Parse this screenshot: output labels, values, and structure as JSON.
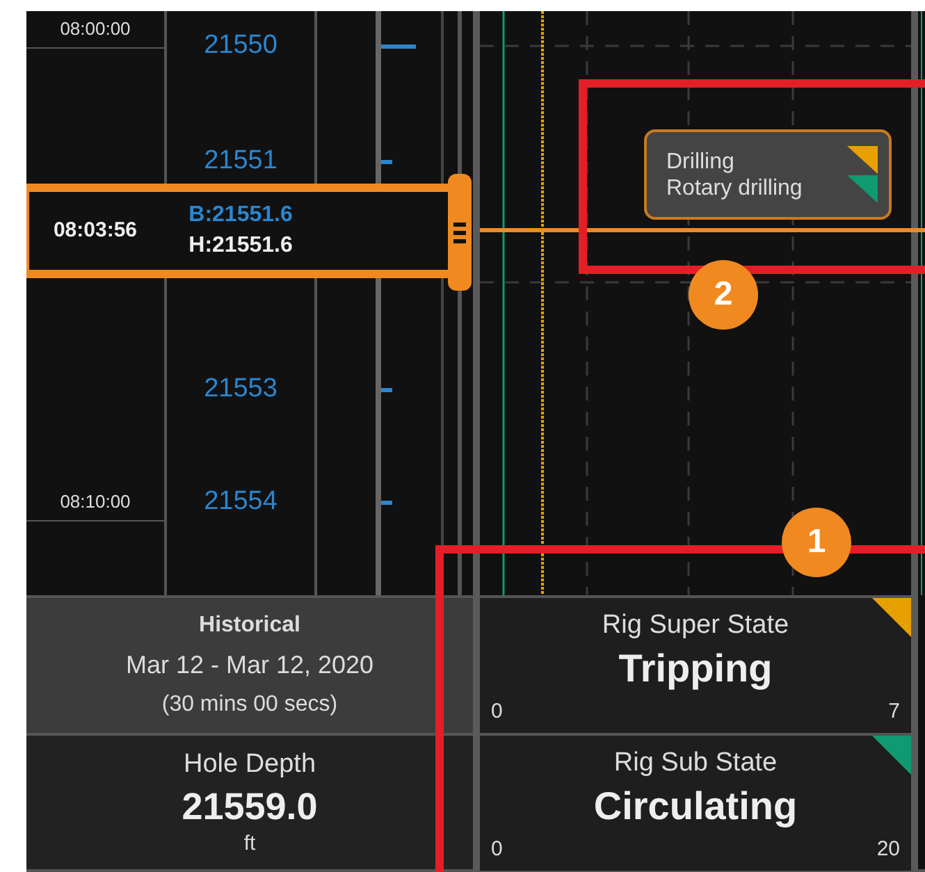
{
  "time_labels": [
    "08:00:00",
    "08:10:00"
  ],
  "depth_labels": [
    {
      "text": "21550",
      "kind": "major"
    },
    {
      "text": "21551",
      "kind": "minor"
    },
    {
      "text": "21553",
      "kind": "minor"
    },
    {
      "text": "21554",
      "kind": "minor"
    }
  ],
  "cursor": {
    "time": "08:03:56",
    "bit_depth": "B:21551.6",
    "hole_depth": "H:21551.6"
  },
  "state_tooltip": {
    "states": [
      {
        "text": "Drilling",
        "color": "#e8a000"
      },
      {
        "text": "Rotary drilling",
        "color": "#0f9a72"
      }
    ]
  },
  "historical": {
    "title": "Historical",
    "date_range": "Mar 12 - Mar 12, 2020",
    "duration": "(30 mins 00 secs)"
  },
  "hole_depth": {
    "label": "Hole Depth",
    "value": "21559.0",
    "unit": "ft"
  },
  "gauges": [
    {
      "label": "Rig Super State",
      "value": "Tripping",
      "min": "0",
      "max": "7",
      "color": "#e8a000"
    },
    {
      "label": "Rig Sub State",
      "value": "Circulating",
      "min": "0",
      "max": "20",
      "color": "#0f9a72"
    }
  ],
  "callouts": [
    {
      "number": "1"
    },
    {
      "number": "2"
    }
  ]
}
